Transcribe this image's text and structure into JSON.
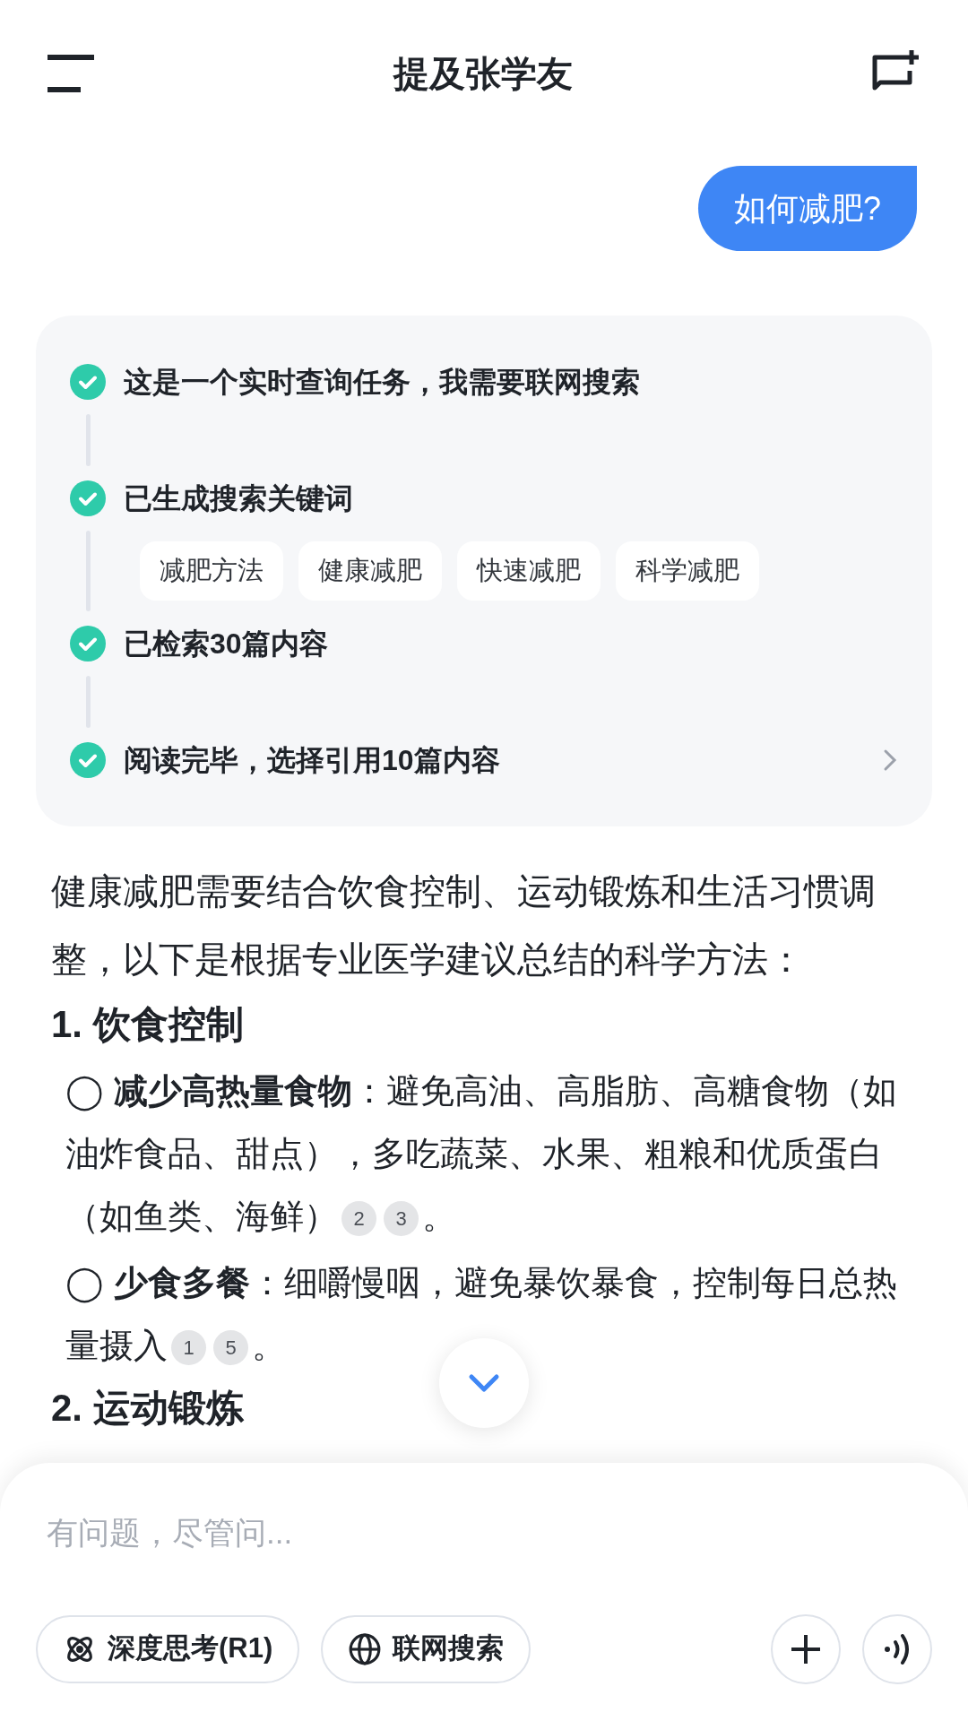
{
  "header": {
    "title": "提及张学友"
  },
  "user_message": "如何减肥?",
  "search_steps": [
    {
      "label": "这是一个实时查询任务，我需要联网搜索",
      "done": true
    },
    {
      "label": "已生成搜索关键词",
      "done": true,
      "keywords": [
        "减肥方法",
        "健康减肥",
        "快速减肥",
        "科学减肥"
      ]
    },
    {
      "label": "已检索30篇内容",
      "done": true
    },
    {
      "label": "阅读完毕，选择引用10篇内容",
      "done": true
    }
  ],
  "answer": [
    {
      "kind": "paragraph",
      "text": "健康减肥需要结合饮食控制、运动锻炼和生活习惯调整，以下是根据专业医学建议总结的科学方法："
    },
    {
      "kind": "heading",
      "text": "1. 饮食控制"
    },
    {
      "kind": "bullet",
      "bullet": "◯",
      "text": "**减少高热量食物**：避免高油、高脂肪、高糖食物（如油炸食品、甜点），多吃蔬菜、水果、粗粮和优质蛋白（如鱼类、海鲜）",
      "citations": [
        "2",
        "3"
      ],
      "end": "。"
    },
    {
      "kind": "bullet",
      "bullet": "◯",
      "text": "**少食多餐**：细嚼慢咽，避免暴饮暴食，控制每日总热量摄入",
      "citations": [
        "1",
        "5"
      ],
      "end": "。"
    },
    {
      "kind": "heading",
      "text": "2. 运动锻炼"
    }
  ],
  "composer": {
    "placeholder": "有问题，尽管问...",
    "modes": [
      {
        "kind": "deep-think",
        "label": "深度思考(R1)",
        "selected": false
      },
      {
        "kind": "web-search",
        "label": "联网搜索",
        "selected": false
      }
    ]
  }
}
